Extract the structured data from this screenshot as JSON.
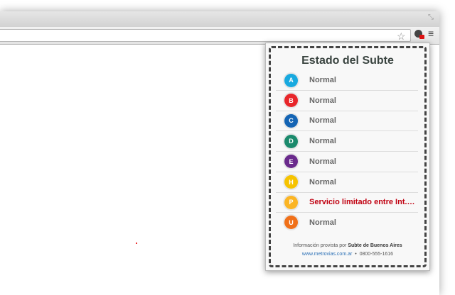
{
  "popup": {
    "title": "Estado del Subte",
    "lines": [
      {
        "letter": "A",
        "status": "Normal",
        "color": "#18a9df",
        "alert": false
      },
      {
        "letter": "B",
        "status": "Normal",
        "color": "#e8262a",
        "alert": false
      },
      {
        "letter": "C",
        "status": "Normal",
        "color": "#1464b4",
        "alert": false
      },
      {
        "letter": "D",
        "status": "Normal",
        "color": "#1b8a6c",
        "alert": false
      },
      {
        "letter": "E",
        "status": "Normal",
        "color": "#6a2a8c",
        "alert": false
      },
      {
        "letter": "H",
        "status": "Normal",
        "color": "#f6c300",
        "alert": false
      },
      {
        "letter": "P",
        "status": "Servicio limitado entre Int. Saguier y ...",
        "color": "#fbb525",
        "alert": true
      },
      {
        "letter": "U",
        "status": "Normal",
        "color": "#f07019",
        "alert": false
      }
    ],
    "footer": {
      "prefix": "Información provista por",
      "source": "Subte de Buenos Aires",
      "link": "www.metrovias.com.ar",
      "sep": "•",
      "phone": "0800-555-1616"
    }
  },
  "toolbar": {
    "star": "☆",
    "menu": "≡",
    "restore": "⤡"
  }
}
